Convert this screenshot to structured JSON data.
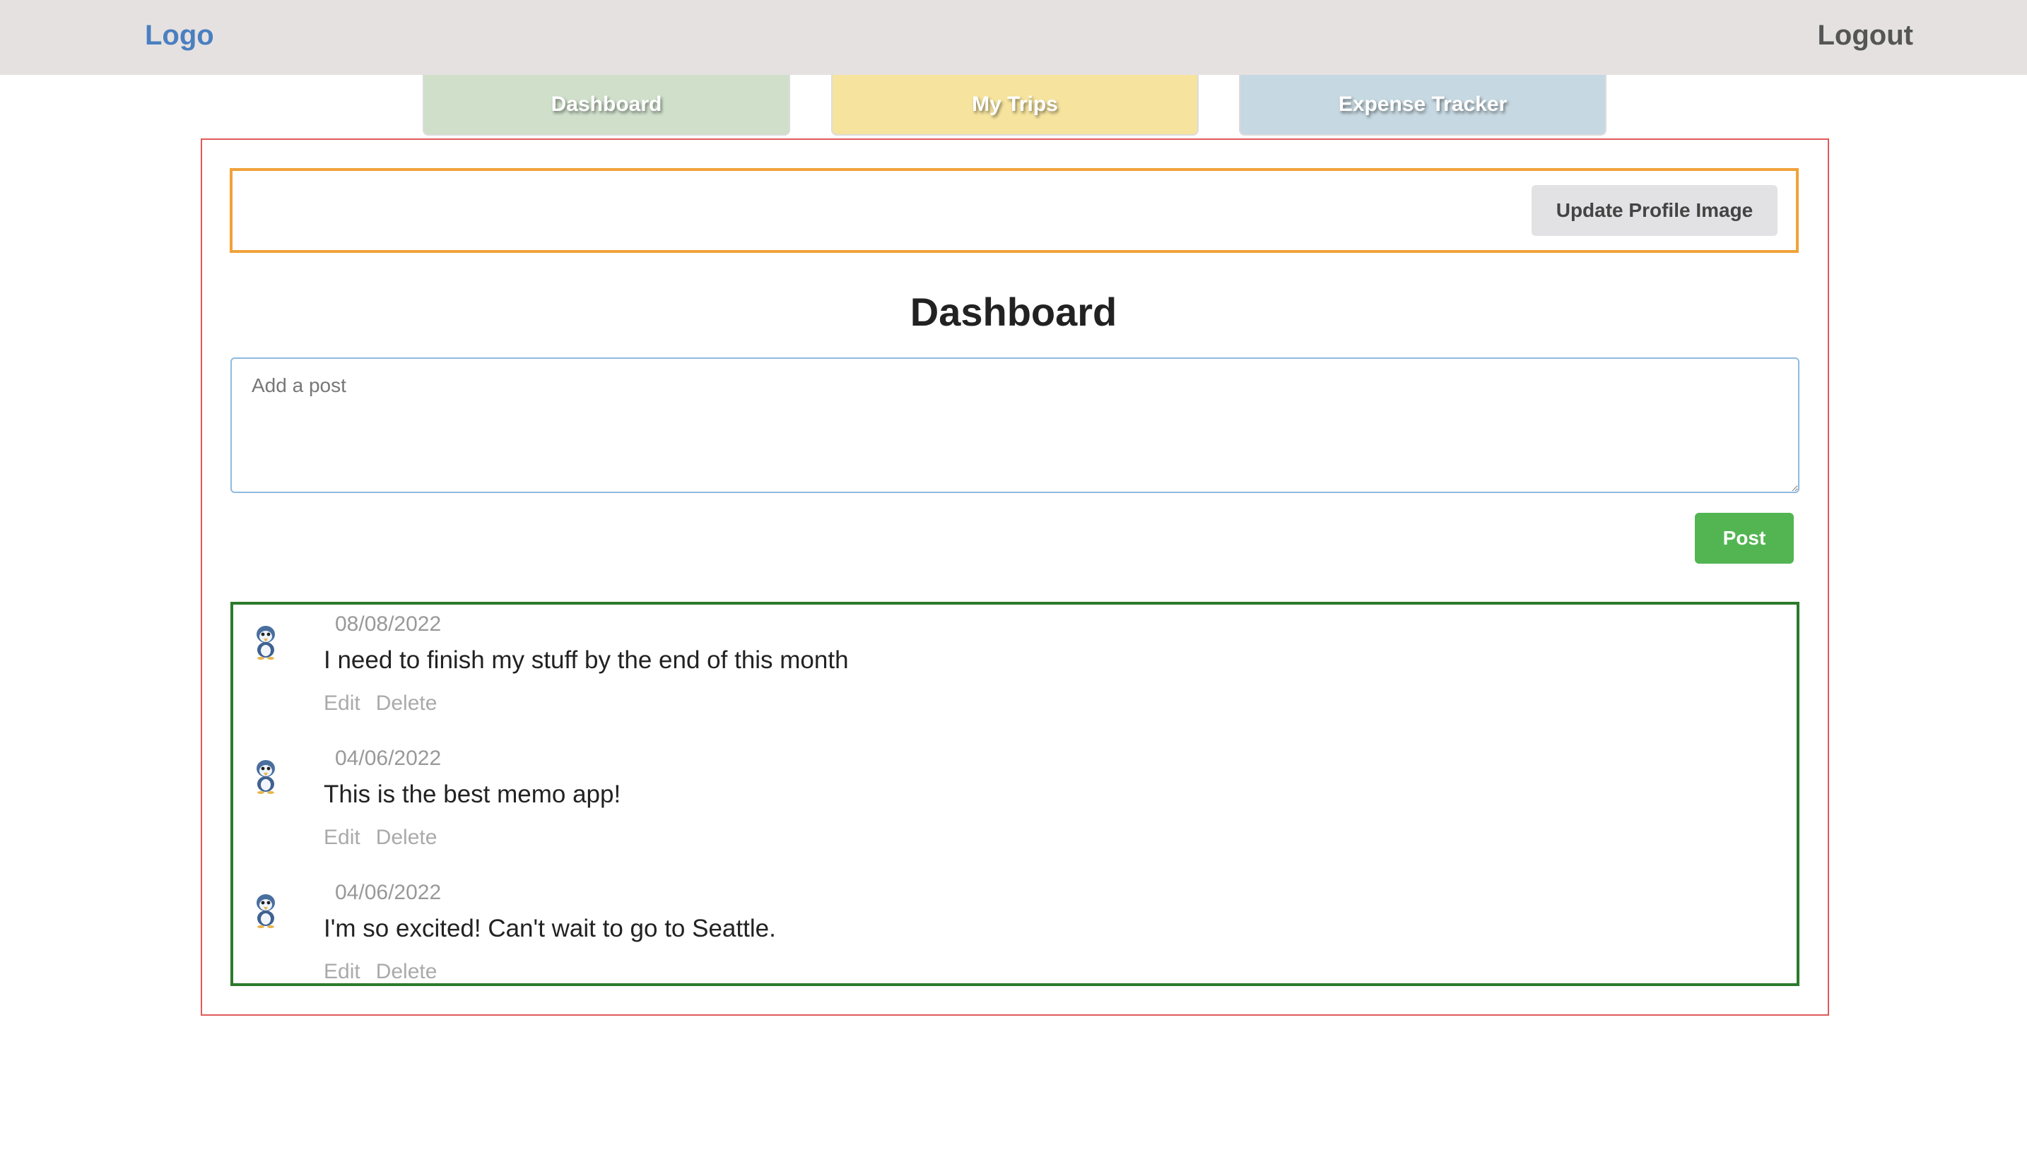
{
  "header": {
    "logo_label": "Logo",
    "logout_label": "Logout"
  },
  "nav": {
    "tabs": [
      {
        "label": "Dashboard",
        "color": "#cfdfca"
      },
      {
        "label": "My Trips",
        "color": "#f6e49e"
      },
      {
        "label": "Expense Tracker",
        "color": "#c6d8e1"
      }
    ]
  },
  "profile": {
    "update_image_label": "Update Profile Image"
  },
  "main": {
    "title": "Dashboard",
    "post_input": {
      "placeholder": "Add a post",
      "value": ""
    },
    "post_button_label": "Post"
  },
  "posts": [
    {
      "date": "08/08/2022",
      "text": "I need to finish my stuff by the end of this month",
      "edit_label": "Edit",
      "delete_label": "Delete",
      "avatar_icon": "penguin-avatar-icon"
    },
    {
      "date": "04/06/2022",
      "text": "This is the best memo app!",
      "edit_label": "Edit",
      "delete_label": "Delete",
      "avatar_icon": "penguin-avatar-icon"
    },
    {
      "date": "04/06/2022",
      "text": "I'm so excited! Can't wait to go to Seattle.",
      "edit_label": "Edit",
      "delete_label": "Delete",
      "avatar_icon": "penguin-avatar-icon"
    }
  ],
  "colors": {
    "header_bg": "#e6e1e1",
    "logo": "#4a7fc0",
    "main_frame_border": "#e05a5a",
    "profile_bar_border": "#f0a23a",
    "posts_border": "#2b7a2b",
    "post_button": "#52b552"
  }
}
